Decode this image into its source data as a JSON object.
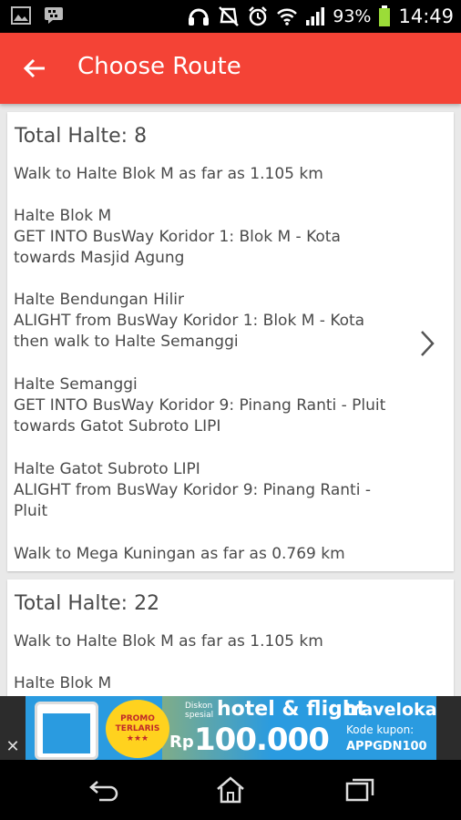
{
  "status_bar": {
    "battery_percent": "93%",
    "time": "14:49",
    "left_icons": [
      "image-notification-icon",
      "bbm-notification-icon"
    ],
    "right_icons": [
      "headset-icon",
      "mute-icon",
      "alarm-icon",
      "wifi-icon",
      "signal-icon",
      "battery-icon"
    ]
  },
  "app_bar": {
    "title": "Choose Route",
    "back_icon": "back-arrow-icon",
    "background_color": "#f44336"
  },
  "routes": [
    {
      "total": "Total Halte: 8",
      "steps": [
        "Walk to Halte Blok M as far as 1.105 km",
        "Halte Blok M\nGET INTO BusWay Koridor 1: Blok M - Kota towards Masjid Agung",
        "Halte Bendungan Hilir\nALIGHT from BusWay Koridor 1: Blok M - Kota then walk to Halte Semanggi",
        "Halte Semanggi\nGET INTO BusWay Koridor 9: Pinang Ranti - Pluit towards Gatot Subroto LIPI",
        "Halte Gatot Subroto LIPI\nALIGHT from BusWay Koridor 9: Pinang Ranti - Pluit",
        "Walk to Mega Kuningan as far as 0.769 km"
      ]
    },
    {
      "total": "Total Halte: 22",
      "steps": [
        "Walk to Halte Blok M as far as 1.105 km",
        "Halte Blok M"
      ]
    }
  ],
  "ad": {
    "badge_line1": "PROMO",
    "badge_line2": "TERLARIS",
    "badge_stars": "★★★",
    "special_line1": "Diskon",
    "special_line2": "spesial",
    "headline": "hotel & flight",
    "currency": "Rp",
    "price": "100.000",
    "brand": "traveloka",
    "coupon_label": "Kode kupon:",
    "coupon_code": "APPGDN100",
    "close_label": "✕"
  },
  "nav_bar": {
    "icons": [
      "back-nav-icon",
      "home-icon",
      "recent-apps-icon"
    ]
  }
}
